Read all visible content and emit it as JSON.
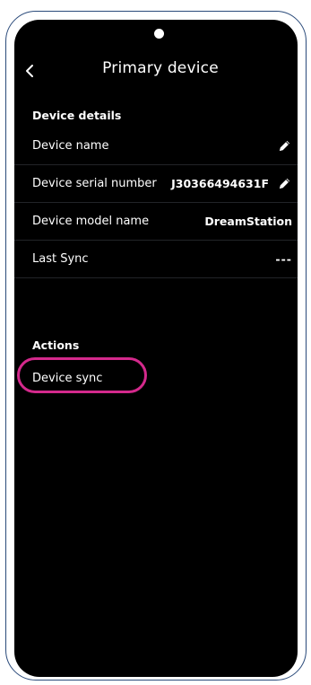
{
  "header": {
    "title": "Primary device",
    "back_icon": "chevron-left-icon"
  },
  "device_details": {
    "heading": "Device details",
    "rows": [
      {
        "label": "Device name",
        "value": "",
        "editable": true
      },
      {
        "label": "Device serial number",
        "value": "J30366494631F",
        "editable": true
      },
      {
        "label": "Device model name",
        "value": "DreamStation",
        "editable": false
      },
      {
        "label": "Last Sync",
        "value": "---",
        "editable": false
      }
    ]
  },
  "actions": {
    "heading": "Actions",
    "device_sync_label": "Device sync"
  },
  "colors": {
    "background": "#000000",
    "text": "#ffffff",
    "highlight": "#d4298c",
    "frame": "#2a4a7a",
    "divider": "#222428"
  }
}
